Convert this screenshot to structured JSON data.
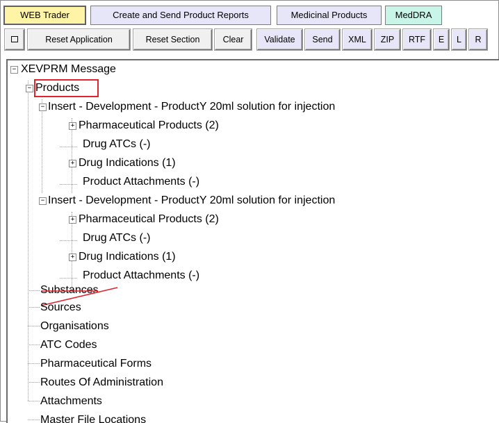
{
  "tabs": [
    {
      "label": "WEB Trader"
    },
    {
      "label": "Create and Send Product Reports"
    },
    {
      "label": "Medicinal Products"
    },
    {
      "label": "MedDRA"
    }
  ],
  "toolbar": {
    "icon": "square-icon",
    "buttons": [
      {
        "label": "Reset Application"
      },
      {
        "label": "Reset Section"
      },
      {
        "label": "Clear"
      },
      {
        "label": "Validate"
      },
      {
        "label": "Send"
      },
      {
        "label": "XML"
      },
      {
        "label": "ZIP"
      },
      {
        "label": "RTF"
      },
      {
        "label": "E"
      },
      {
        "label": "L"
      },
      {
        "label": "R"
      }
    ]
  },
  "tree": {
    "root": "XEVPRM Message",
    "products": "Products",
    "product_items": [
      {
        "label": "Insert - Development - ProductY 20ml solution for injection",
        "children": [
          {
            "label": "Pharmaceutical Products (2)"
          },
          {
            "label": "Drug ATCs (-)"
          },
          {
            "label": "Drug Indications (1)"
          },
          {
            "label": "Product Attachments (-)"
          }
        ]
      },
      {
        "label": "Insert - Development - ProductY 20ml solution for injection",
        "children": [
          {
            "label": "Pharmaceutical Products (2)"
          },
          {
            "label": "Drug ATCs (-)"
          },
          {
            "label": "Drug Indications (1)"
          },
          {
            "label": "Product Attachments (-)"
          }
        ]
      }
    ],
    "sections": [
      {
        "label": "Substances"
      },
      {
        "label": "Sources"
      },
      {
        "label": "Organisations"
      },
      {
        "label": "ATC Codes"
      },
      {
        "label": "Pharmaceutical Forms"
      },
      {
        "label": "Routes Of Administration"
      },
      {
        "label": "Attachments"
      },
      {
        "label": "Master File Locations"
      }
    ]
  },
  "colors": {
    "active_tab": "#fff3a6",
    "lilac": "#e7e6f8",
    "mint": "#c9f5e8",
    "highlight": "#e0242f"
  }
}
